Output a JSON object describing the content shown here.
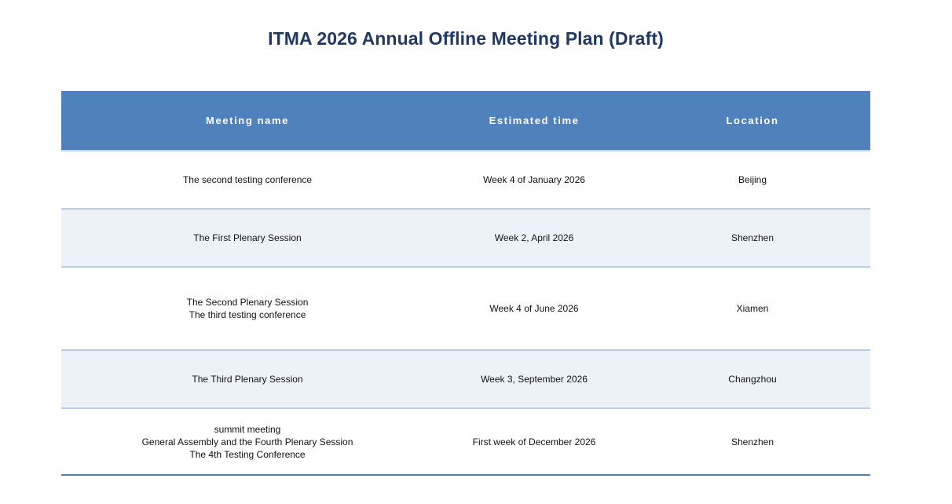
{
  "document": {
    "title": "ITMA 2026 Annual Offline Meeting Plan (Draft)"
  },
  "table": {
    "columns": [
      "Meeting name",
      "Estimated time",
      "Location"
    ],
    "rows": [
      {
        "name_lines": [
          "The second testing conference"
        ],
        "time": "Week 4 of January 2026",
        "location": "Beijing"
      },
      {
        "name_lines": [
          "The First Plenary Session"
        ],
        "time": "Week 2, April 2026",
        "location": "Shenzhen"
      },
      {
        "name_lines": [
          "The Second Plenary Session",
          "The third testing conference"
        ],
        "time": "Week 4 of June 2026",
        "location": "Xiamen"
      },
      {
        "name_lines": [
          "The Third Plenary Session"
        ],
        "time": "Week 3, September 2026",
        "location": "Changzhou"
      },
      {
        "name_lines": [
          "summit meeting",
          "General Assembly and the Fourth Plenary Session",
          "The 4th Testing Conference"
        ],
        "time": "First week of December 2026",
        "location": "Shenzhen"
      }
    ]
  },
  "colors": {
    "title": "#1f3864",
    "header_bg": "#4f81bd",
    "alt_row_bg": "#edf2f9",
    "row_border": "#b8cce4"
  }
}
